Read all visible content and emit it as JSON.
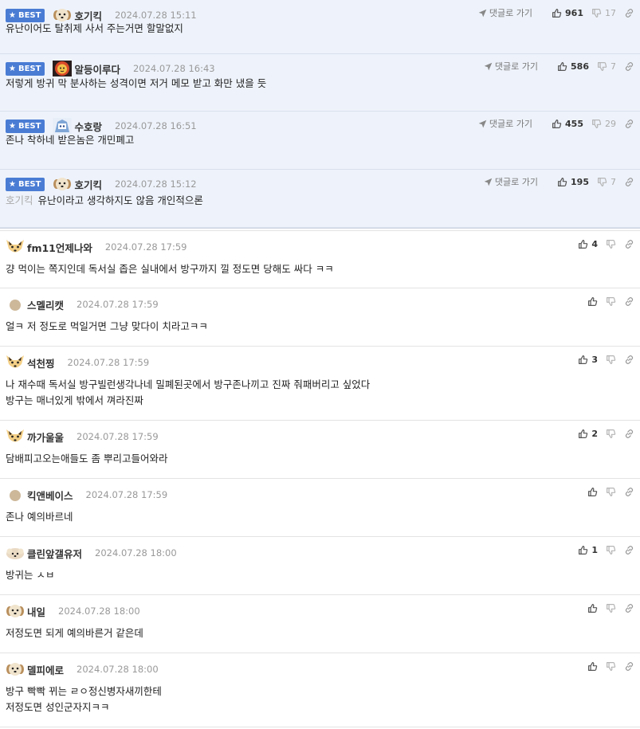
{
  "labels": {
    "best": "BEST",
    "goto": "댓글로 가기"
  },
  "best_comments": [
    {
      "avatar": "puppy",
      "nick": "호기킥",
      "date": "2024.07.28 15:11",
      "up": "961",
      "down": "17",
      "text": "유난이어도 탈취제 사서 주는거면 할말없지",
      "quote": ""
    },
    {
      "avatar": "lion",
      "nick": "알등이루다",
      "date": "2024.07.28 16:43",
      "up": "586",
      "down": "7",
      "text": "저렇게 방귀 막 분사하는 성격이면 저거 메모 받고 화만 냈을 듯",
      "quote": ""
    },
    {
      "avatar": "robot",
      "nick": "수호랑",
      "date": "2024.07.28 16:51",
      "up": "455",
      "down": "29",
      "text": "존나 착하네 받은놈은 개민폐고",
      "quote": ""
    },
    {
      "avatar": "puppy",
      "nick": "호기킥",
      "date": "2024.07.28 15:12",
      "up": "195",
      "down": "7",
      "text": "유난이라고 생각하지도 않음 개인적으론",
      "quote": "호기킥"
    }
  ],
  "comments": [
    {
      "avatar": "fox",
      "nick": "fm11언제나와",
      "date": "2024.07.28 17:59",
      "up": "4",
      "lines": [
        "걍 먹이는 쪽지인데 독서실 좁은 실내에서 방구까지 낄 정도면 당해도 싸다 ㅋㅋ"
      ]
    },
    {
      "avatar": "circle",
      "nick": "스멜리캣",
      "date": "2024.07.28 17:59",
      "up": "",
      "lines": [
        "얼ㅋ 저 정도로 먹일거면 그냥 맞다이 치라고ㅋㅋ"
      ]
    },
    {
      "avatar": "fox",
      "nick": "석천찡",
      "date": "2024.07.28 17:59",
      "up": "3",
      "lines": [
        "나 재수때 독서실 방구빌런생각나네 밀폐된곳에서 방구존나끼고 진짜 줘패버리고 싶었다",
        "방구는 매너있게 밖에서 껴라진짜"
      ]
    },
    {
      "avatar": "fox",
      "nick": "까가울울",
      "date": "2024.07.28 17:59",
      "up": "2",
      "lines": [
        "담배피고오는애들도 좀 뿌리고들어와라"
      ]
    },
    {
      "avatar": "circle",
      "nick": "킥앤베이스",
      "date": "2024.07.28 17:59",
      "up": "",
      "lines": [
        "존나 예의바르네"
      ]
    },
    {
      "avatar": "sheep",
      "nick": "클린앞갤유저",
      "date": "2024.07.28 18:00",
      "up": "1",
      "lines": [
        "방귀는 ㅅㅂ"
      ]
    },
    {
      "avatar": "puppy",
      "nick": "내일",
      "date": "2024.07.28 18:00",
      "up": "",
      "lines": [
        "저정도면 되게 예의바른거 같은데"
      ]
    },
    {
      "avatar": "puppy",
      "nick": "델피에로",
      "date": "2024.07.28 18:00",
      "up": "",
      "lines": [
        "방구 빡빡 뀌는 ㄹㅇ정신병자새끼한테",
        "저정도면 성인군자지ㅋㅋ"
      ]
    }
  ]
}
